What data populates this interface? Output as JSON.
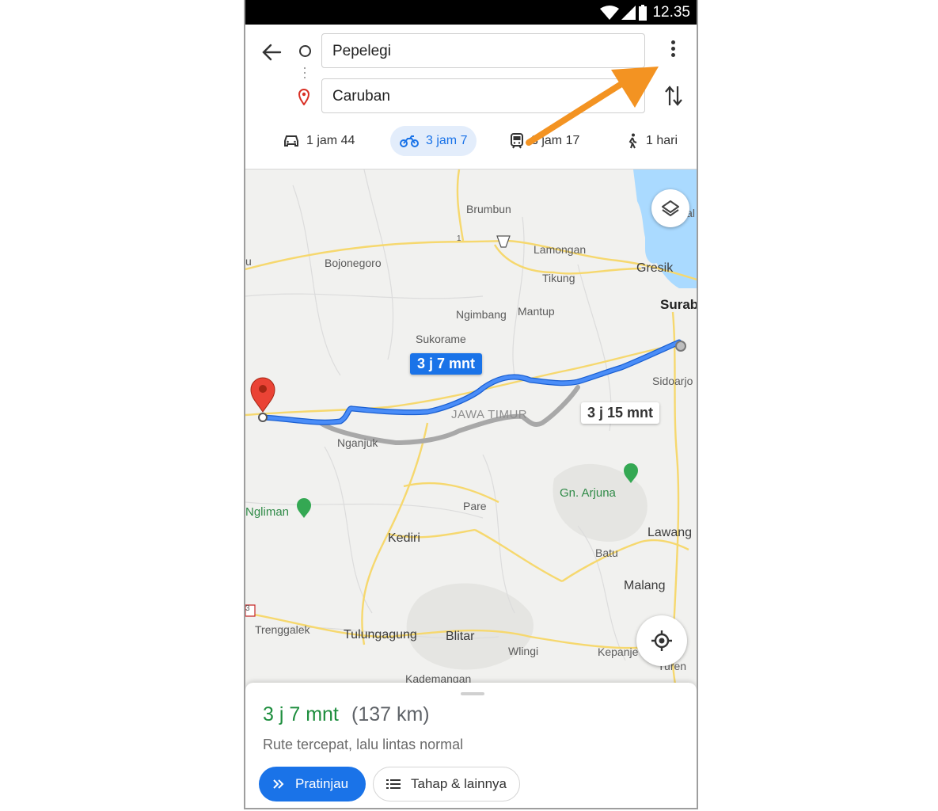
{
  "status": {
    "time": "12.35"
  },
  "route": {
    "origin": "Pepelegi",
    "destination": "Caruban"
  },
  "modes": [
    {
      "label": "1 jam 44",
      "icon": "car-icon"
    },
    {
      "label": "3 jam 7",
      "icon": "motorcycle-icon",
      "selected": true
    },
    {
      "label": "3 jam 17",
      "icon": "transit-icon"
    },
    {
      "label": "1 hari",
      "icon": "walk-icon"
    }
  ],
  "map": {
    "route_labels": {
      "primary": "3 j 7 mnt",
      "alternate": "3 j 15 mnt"
    },
    "places": {
      "brumbun": "Brumbun",
      "lamongan": "Lamongan",
      "bojonegoro": "Bojonegoro",
      "tikung": "Tikung",
      "gresik": "Gresik",
      "surabaya": "Surab",
      "ngimbang": "Ngimbang",
      "mantup": "Mantup",
      "sukorame": "Sukorame",
      "sidoarjo": "Sidoarjo",
      "jawa_timur": "JAWA TIMUR",
      "nganjuk": "Nganjuk",
      "gn_arjuna": "Gn. Arjuna",
      "pare": "Pare",
      "ngliman": "Ngliman",
      "lawang": "Lawang",
      "kediri": "Kediri",
      "batu": "Batu",
      "malang": "Malang",
      "trenggalek": "Trenggalek",
      "tulungagung": "Tulungagung",
      "blitar": "Blitar",
      "wlingi": "Wlingi",
      "kepanjen": "Kepanje",
      "turen": "Turen",
      "kademangan": "Kademangan",
      "edge_u": "u",
      "edge_jal": "jal"
    },
    "road_shields": {
      "route_1": "1",
      "route_3": "3"
    }
  },
  "summary": {
    "duration": "3 j 7 mnt",
    "distance": "(137 km)",
    "description": "Rute tercepat, lalu lintas normal",
    "preview_label": "Pratinjau",
    "steps_label": "Tahap & lainnya"
  },
  "colors": {
    "accent": "#1a73e8",
    "duration_green": "#1e8e3e",
    "annotation_arrow": "#f39322",
    "route_blue": "#4285f4",
    "route_gray": "#a8a8a8"
  }
}
